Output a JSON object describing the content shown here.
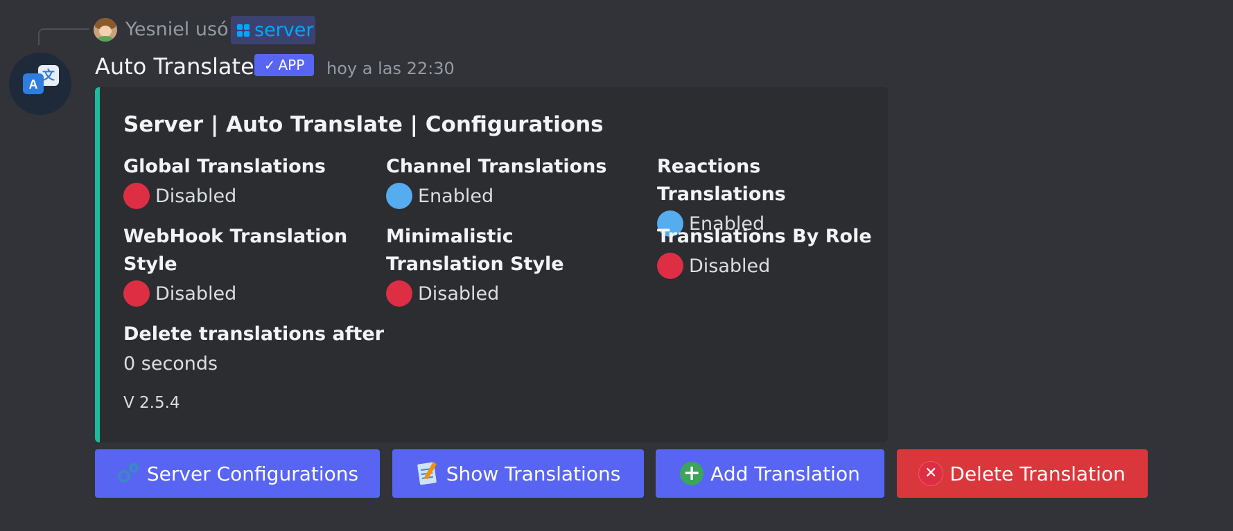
{
  "reply": {
    "user": "Yesniel",
    "verb": "usó",
    "command": "server"
  },
  "message": {
    "author": "Auto Translate",
    "badge": "APP",
    "timestamp": "hoy a las 22:30"
  },
  "embed": {
    "accent_color": "#1abc9c",
    "title": "Server | Auto Translate | Configurations",
    "fields": [
      {
        "name": "Global Translations",
        "status": "red",
        "value": "Disabled"
      },
      {
        "name": "Channel Translations",
        "status": "blue",
        "value": "Enabled"
      },
      {
        "name": "Reactions Translations",
        "status": "blue",
        "value": "Enabled"
      },
      {
        "name": "WebHook Translation Style",
        "status": "red",
        "value": "Disabled"
      },
      {
        "name": "Minimalistic Translation Style",
        "status": "red",
        "value": "Disabled"
      },
      {
        "name": "Translations By Role",
        "status": "red",
        "value": "Disabled"
      }
    ],
    "delete_field": {
      "name": "Delete translations after",
      "value": "0 seconds"
    },
    "footer": "V 2.5.4"
  },
  "buttons": [
    {
      "label": "Server Configurations",
      "icon": "gears-icon",
      "style": "blurple"
    },
    {
      "label": "Show Translations",
      "icon": "memo-icon",
      "style": "blurple"
    },
    {
      "label": "Add Translation",
      "icon": "plus-circle-icon",
      "style": "blurple"
    },
    {
      "label": "Delete Translation",
      "icon": "x-circle-icon",
      "style": "red"
    }
  ],
  "colors": {
    "background": "#313338",
    "blurple": "#5865f2",
    "danger": "#da373c",
    "status_red": "#dd2e44",
    "status_blue": "#55acee"
  }
}
